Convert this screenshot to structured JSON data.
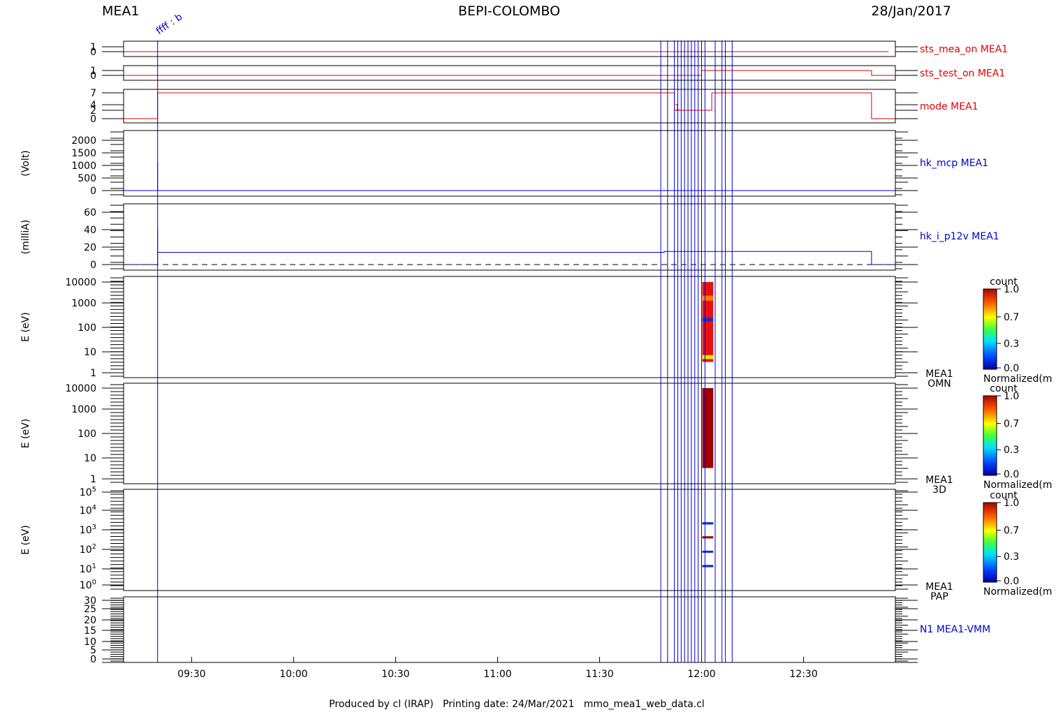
{
  "header": {
    "left": "MEA1",
    "center": "BEPI-COLOMBO",
    "right": "28/Jan/2017"
  },
  "footer": "Produced by cl (IRAP)   Printing date: 24/Mar/2021   mmo_mea1_web_data.cl",
  "colors": {
    "red": "#e00000",
    "blue": "#0000cc",
    "black": "#000000",
    "darkred": "#a00000"
  },
  "time_axis": {
    "ticks": [
      "09:30",
      "10:00",
      "10:30",
      "11:00",
      "11:30",
      "12:00",
      "12:30"
    ]
  },
  "events": {
    "first_label": "ffff : b",
    "lines": [
      "11:48",
      "11:50",
      "11:52",
      "11:53",
      "11:54",
      "11:55",
      "11:56",
      "11:57",
      "11:58",
      "11:59",
      "12:00",
      "12:01",
      "12:04",
      "12:06",
      "12:07",
      "12:09"
    ]
  },
  "colorbar": {
    "title": "count",
    "ticks": [
      "1.0",
      "0.7",
      "0.3",
      "0.0"
    ],
    "caption": "Normalized(m"
  },
  "chart_data": [
    {
      "type": "line",
      "name": "sts_mea_on",
      "label": "sts_mea_on MEA1",
      "color": "red",
      "yticks": [
        "1",
        "0"
      ],
      "points": [
        [
          "09:10",
          0
        ],
        [
          "12:55",
          0
        ]
      ]
    },
    {
      "type": "line",
      "name": "sts_test_on",
      "label": "sts_test_on MEA1",
      "color": "red",
      "yticks": [
        "1",
        "0"
      ],
      "points": [
        [
          "09:10",
          0
        ],
        [
          "12:00",
          0
        ],
        [
          "12:00",
          1
        ],
        [
          "12:50",
          1
        ],
        [
          "12:50",
          0
        ],
        [
          "12:57",
          0
        ]
      ]
    },
    {
      "type": "line",
      "name": "mode",
      "label": "mode MEA1",
      "color": "red",
      "yticks": [
        "7",
        "4",
        "2",
        "0"
      ],
      "points": [
        [
          "09:10",
          0
        ],
        [
          "09:20",
          0
        ],
        [
          "09:20",
          7
        ],
        [
          "11:52",
          7
        ],
        [
          "11:52",
          3
        ],
        [
          "12:03",
          3
        ],
        [
          "12:03",
          7
        ],
        [
          "12:50",
          7
        ],
        [
          "12:50",
          0
        ],
        [
          "12:57",
          0
        ]
      ],
      "annotation": "1"
    },
    {
      "type": "line",
      "name": "hk_mcp",
      "label": "hk_mcp MEA1",
      "ylabel": "(Volt)",
      "color": "blue",
      "yticks": [
        "2000",
        "1500",
        "1000",
        "500",
        "0"
      ],
      "ylim": [
        0,
        2000
      ],
      "points": [
        [
          "09:10",
          0
        ],
        [
          "09:20",
          0
        ],
        [
          "09:20",
          1150
        ],
        [
          "09:20",
          0
        ],
        [
          "11:49",
          0
        ],
        [
          "11:49",
          30
        ],
        [
          "11:49",
          0
        ],
        [
          "12:07",
          0
        ],
        [
          "12:07",
          30
        ],
        [
          "12:07",
          0
        ],
        [
          "12:57",
          0
        ]
      ]
    },
    {
      "type": "line",
      "name": "hk_i_p12v",
      "label": "hk_i_p12v MEA1",
      "ylabel": "(milliA)",
      "color": "blue",
      "yticks": [
        "60",
        "40",
        "20",
        "0"
      ],
      "ylim": [
        0,
        60
      ],
      "points": [
        [
          "09:10",
          0
        ],
        [
          "09:20",
          0
        ],
        [
          "09:20",
          40
        ],
        [
          "09:20",
          14
        ],
        [
          "11:49",
          14
        ],
        [
          "11:49",
          15
        ],
        [
          "12:50",
          15
        ],
        [
          "12:50",
          0
        ],
        [
          "12:57",
          0
        ]
      ]
    },
    {
      "type": "heatmap",
      "name": "omn",
      "label": "MEA1",
      "label2": "OMN",
      "ylabel": "E (eV)",
      "scale": "log",
      "yticks": [
        "10000",
        "1000",
        "100",
        "10",
        "1"
      ],
      "ylim": [
        1,
        10000
      ],
      "cells": [
        [
          "12:00",
          "12:02",
          3,
          10000,
          "red"
        ],
        [
          "12:00",
          "12:02",
          1500,
          2500,
          "orange"
        ],
        [
          "12:00",
          "12:02",
          180,
          260,
          "blue"
        ],
        [
          "12:00",
          "12:02",
          4,
          6,
          "yellow"
        ]
      ]
    },
    {
      "type": "heatmap",
      "name": "3d",
      "label": "MEA1",
      "label2": "3D",
      "ylabel": "E (eV)",
      "scale": "log",
      "yticks": [
        "10000",
        "1000",
        "100",
        "10",
        "1"
      ],
      "ylim": [
        1,
        10000
      ],
      "cells": [
        [
          "12:00",
          "12:02",
          3,
          10000,
          "darkred"
        ]
      ]
    },
    {
      "type": "heatmap",
      "name": "pap",
      "label": "MEA1",
      "label2": "PAP",
      "ylabel": "E (eV)",
      "scale": "log",
      "yticks": [
        "10^5",
        "10^4",
        "10^3",
        "10^2",
        "10^1",
        "10^0"
      ],
      "ylim": [
        1,
        100000
      ],
      "cells": [
        [
          "12:00",
          "12:02",
          1800,
          2400,
          "blue"
        ],
        [
          "12:00",
          "12:02",
          320,
          420,
          "darkred"
        ],
        [
          "12:00",
          "12:02",
          55,
          70,
          "blue"
        ],
        [
          "12:00",
          "12:02",
          9,
          12,
          "blue"
        ]
      ]
    },
    {
      "type": "line",
      "name": "vmm",
      "label": "N1 MEA1-VMM",
      "color": "blue",
      "yticks": [
        "30",
        "25",
        "20",
        "15",
        "10",
        "5",
        "0"
      ],
      "ylim": [
        0,
        30
      ],
      "points": []
    }
  ]
}
